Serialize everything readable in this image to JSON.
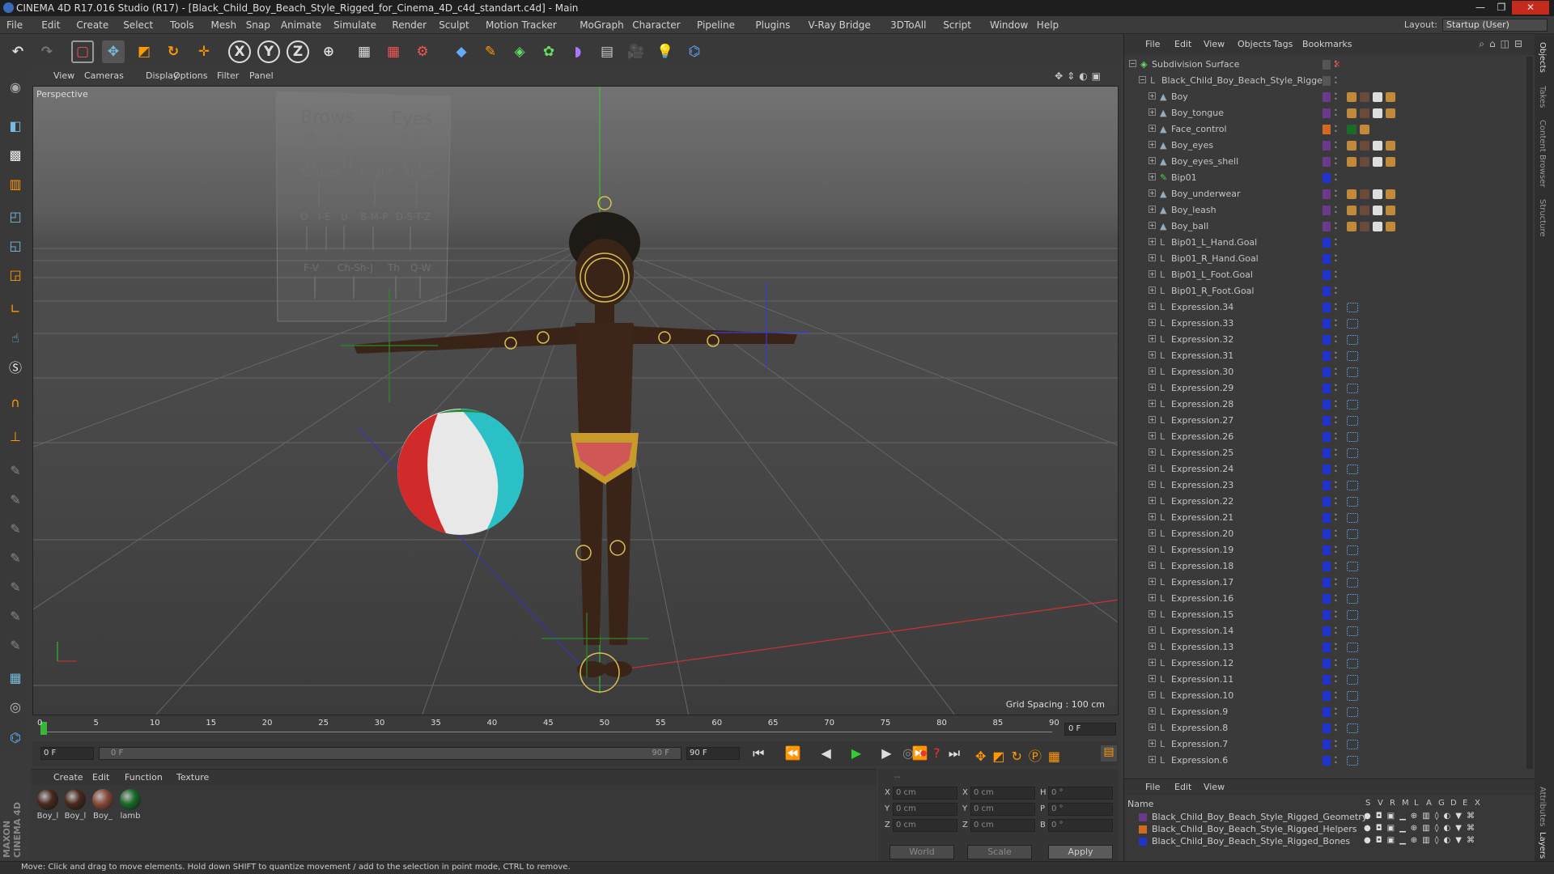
{
  "window": {
    "title": "CINEMA 4D R17.016 Studio (R17) - [Black_Child_Boy_Beach_Style_Rigged_for_Cinema_4D_c4d_standart.c4d] - Main"
  },
  "menu": [
    "File",
    "Edit",
    "Create",
    "Select",
    "Tools",
    "Mesh",
    "Snap",
    "Animate",
    "Simulate",
    "Render",
    "Sculpt",
    "Motion Tracker",
    "MoGraph",
    "Character",
    "Pipeline",
    "Plugins",
    "V-Ray Bridge",
    "3DToAll",
    "Script",
    "Window",
    "Help"
  ],
  "layout": {
    "label": "Layout:",
    "value": "Startup (User)"
  },
  "viewport": {
    "menu": [
      "View",
      "Cameras",
      "Display",
      "Options",
      "Filter",
      "Panel"
    ],
    "label": "Perspective",
    "grid_spacing": "Grid Spacing : 100 cm",
    "face_rig": {
      "brows": "Brows",
      "eyes": "Eyes",
      "brows_r": "R",
      "brows_l": "L",
      "eyes_r": "R",
      "eyes_l": "L",
      "smiles": "Smiles",
      "fright": "Fright",
      "anger": "Anger",
      "visemes1": [
        "O",
        "I-E",
        "U",
        "B-M-P",
        "D-S-T-Z"
      ],
      "visemes2": [
        "F-V",
        "Ch-Sh-J",
        "Th",
        "Q-W"
      ]
    }
  },
  "timeline": {
    "ticks": [
      "0",
      "5",
      "10",
      "15",
      "20",
      "25",
      "30",
      "35",
      "40",
      "45",
      "50",
      "55",
      "60",
      "65",
      "70",
      "75",
      "80",
      "85",
      "90"
    ],
    "end_field": "0 F",
    "start": "0 F",
    "range_start": "0 F",
    "range_end": "90 F",
    "end": "90 F"
  },
  "materials": {
    "menu": [
      "Create",
      "Edit",
      "Function",
      "Texture"
    ],
    "items": [
      "Boy_l",
      "Boy_l",
      "Boy_",
      "lamb"
    ]
  },
  "coords": {
    "x": "X",
    "y": "Y",
    "z": "Z",
    "h": "H",
    "p": "P",
    "b": "B",
    "pos": "0 cm",
    "rot": "0 °",
    "world": "World",
    "scale": "Scale",
    "apply": "Apply",
    "header": "--"
  },
  "objects": {
    "menu": [
      "File",
      "Edit",
      "View",
      "Objects",
      "Tags",
      "Bookmarks"
    ],
    "rows": [
      {
        "name": "Subdivision Surface",
        "indent": 0,
        "icon": "subdivision-icon",
        "color": "#555"
      },
      {
        "name": "Black_Child_Boy_Beach_Style_Rigged",
        "indent": 1,
        "icon": "null-icon",
        "color": "#555"
      },
      {
        "name": "Boy",
        "indent": 2,
        "icon": "polygon-icon",
        "color": "#6a3a8a"
      },
      {
        "name": "Boy_tongue",
        "indent": 2,
        "icon": "polygon-icon",
        "color": "#6a3a8a"
      },
      {
        "name": "Face_control",
        "indent": 2,
        "icon": "polygon-icon",
        "color": "#d06a20"
      },
      {
        "name": "Boy_eyes",
        "indent": 2,
        "icon": "polygon-icon",
        "color": "#6a3a8a"
      },
      {
        "name": "Boy_eyes_shell",
        "indent": 2,
        "icon": "polygon-icon",
        "color": "#6a3a8a"
      },
      {
        "name": "Bip01",
        "indent": 2,
        "icon": "bone-icon",
        "color": "#2233cc"
      },
      {
        "name": "Boy_underwear",
        "indent": 2,
        "icon": "polygon-icon",
        "color": "#6a3a8a"
      },
      {
        "name": "Boy_leash",
        "indent": 2,
        "icon": "polygon-icon",
        "color": "#6a3a8a"
      },
      {
        "name": "Boy_ball",
        "indent": 2,
        "icon": "polygon-icon",
        "color": "#6a3a8a"
      },
      {
        "name": "Bip01_L_Hand.Goal",
        "indent": 2,
        "icon": "null-icon",
        "color": "#2233cc"
      },
      {
        "name": "Bip01_R_Hand.Goal",
        "indent": 2,
        "icon": "null-icon",
        "color": "#2233cc"
      },
      {
        "name": "Bip01_L_Foot.Goal",
        "indent": 2,
        "icon": "null-icon",
        "color": "#2233cc"
      },
      {
        "name": "Bip01_R_Foot.Goal",
        "indent": 2,
        "icon": "null-icon",
        "color": "#2233cc"
      },
      {
        "name": "Expression.34",
        "indent": 2,
        "icon": "null-icon",
        "color": "#2233cc"
      },
      {
        "name": "Expression.33",
        "indent": 2,
        "icon": "null-icon",
        "color": "#2233cc"
      },
      {
        "name": "Expression.32",
        "indent": 2,
        "icon": "null-icon",
        "color": "#2233cc"
      },
      {
        "name": "Expression.31",
        "indent": 2,
        "icon": "null-icon",
        "color": "#2233cc"
      },
      {
        "name": "Expression.30",
        "indent": 2,
        "icon": "null-icon",
        "color": "#2233cc"
      },
      {
        "name": "Expression.29",
        "indent": 2,
        "icon": "null-icon",
        "color": "#2233cc"
      },
      {
        "name": "Expression.28",
        "indent": 2,
        "icon": "null-icon",
        "color": "#2233cc"
      },
      {
        "name": "Expression.27",
        "indent": 2,
        "icon": "null-icon",
        "color": "#2233cc"
      },
      {
        "name": "Expression.26",
        "indent": 2,
        "icon": "null-icon",
        "color": "#2233cc"
      },
      {
        "name": "Expression.25",
        "indent": 2,
        "icon": "null-icon",
        "color": "#2233cc"
      },
      {
        "name": "Expression.24",
        "indent": 2,
        "icon": "null-icon",
        "color": "#2233cc"
      },
      {
        "name": "Expression.23",
        "indent": 2,
        "icon": "null-icon",
        "color": "#2233cc"
      },
      {
        "name": "Expression.22",
        "indent": 2,
        "icon": "null-icon",
        "color": "#2233cc"
      },
      {
        "name": "Expression.21",
        "indent": 2,
        "icon": "null-icon",
        "color": "#2233cc"
      },
      {
        "name": "Expression.20",
        "indent": 2,
        "icon": "null-icon",
        "color": "#2233cc"
      },
      {
        "name": "Expression.19",
        "indent": 2,
        "icon": "null-icon",
        "color": "#2233cc"
      },
      {
        "name": "Expression.18",
        "indent": 2,
        "icon": "null-icon",
        "color": "#2233cc"
      },
      {
        "name": "Expression.17",
        "indent": 2,
        "icon": "null-icon",
        "color": "#2233cc"
      },
      {
        "name": "Expression.16",
        "indent": 2,
        "icon": "null-icon",
        "color": "#2233cc"
      },
      {
        "name": "Expression.15",
        "indent": 2,
        "icon": "null-icon",
        "color": "#2233cc"
      },
      {
        "name": "Expression.14",
        "indent": 2,
        "icon": "null-icon",
        "color": "#2233cc"
      },
      {
        "name": "Expression.13",
        "indent": 2,
        "icon": "null-icon",
        "color": "#2233cc"
      },
      {
        "name": "Expression.12",
        "indent": 2,
        "icon": "null-icon",
        "color": "#2233cc"
      },
      {
        "name": "Expression.11",
        "indent": 2,
        "icon": "null-icon",
        "color": "#2233cc"
      },
      {
        "name": "Expression.10",
        "indent": 2,
        "icon": "null-icon",
        "color": "#2233cc"
      },
      {
        "name": "Expression.9",
        "indent": 2,
        "icon": "null-icon",
        "color": "#2233cc"
      },
      {
        "name": "Expression.8",
        "indent": 2,
        "icon": "null-icon",
        "color": "#2233cc"
      },
      {
        "name": "Expression.7",
        "indent": 2,
        "icon": "null-icon",
        "color": "#2233cc"
      },
      {
        "name": "Expression.6",
        "indent": 2,
        "icon": "null-icon",
        "color": "#2233cc"
      }
    ]
  },
  "layers": {
    "menu": [
      "File",
      "Edit",
      "View"
    ],
    "name_header": "Name",
    "cols": [
      "S",
      "V",
      "R",
      "M",
      "L",
      "A",
      "G",
      "D",
      "E",
      "X"
    ],
    "rows": [
      {
        "name": "Black_Child_Boy_Beach_Style_Rigged_Geometry",
        "color": "#6a3a8a"
      },
      {
        "name": "Black_Child_Boy_Beach_Style_Rigged_Helpers",
        "color": "#d06a20"
      },
      {
        "name": "Black_Child_Boy_Beach_Style_Rigged_Bones",
        "color": "#2233cc"
      }
    ]
  },
  "side_tabs": [
    "Objects",
    "Takes",
    "Content Browser",
    "Structure"
  ],
  "side_tabs_bottom": [
    "Attributes",
    "Layers"
  ],
  "status": "Move: Click and drag to move elements. Hold down SHIFT to quantize movement / add to the selection in point mode, CTRL to remove.",
  "brand": "MAXON CINEMA 4D"
}
